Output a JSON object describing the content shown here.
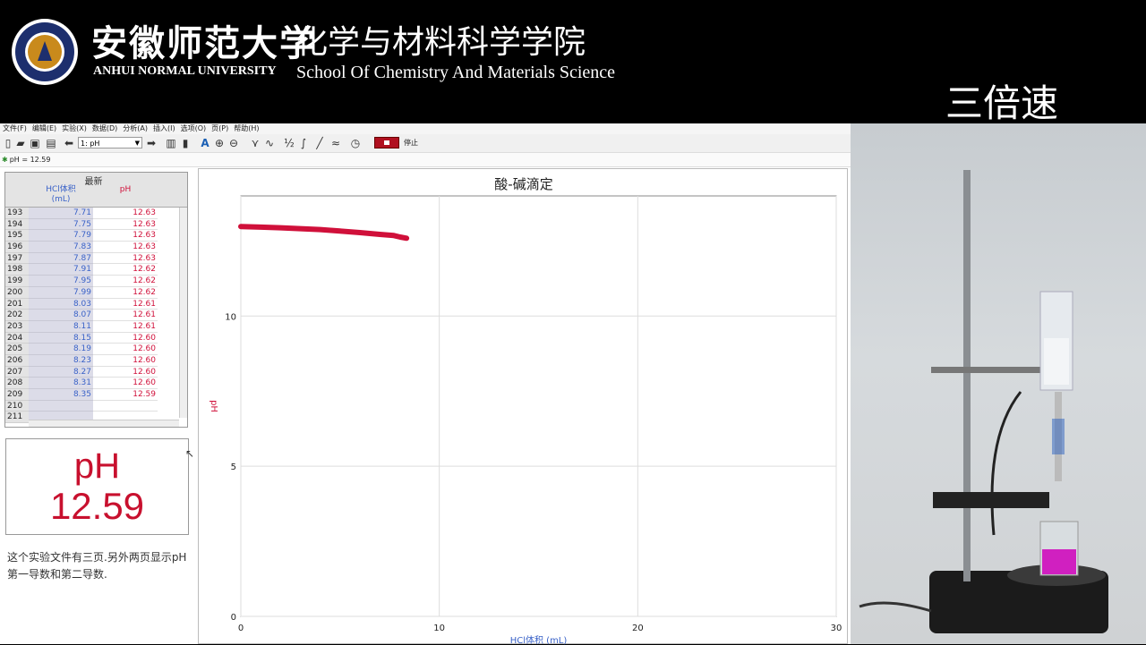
{
  "banner": {
    "university_cn": "安徽师范大学",
    "university_en": "ANHUI NORMAL UNIVERSITY",
    "school_cn": "化学与材料科学学院",
    "school_en": "School Of  Chemistry And Materials Science",
    "speed_label": "三倍速"
  },
  "menu": [
    "文件(F)",
    "编辑(E)",
    "实验(X)",
    "数据(D)",
    "分析(A)",
    "插入(I)",
    "选项(O)",
    "页(P)",
    "帮助(H)"
  ],
  "toolbar": {
    "run_select": "1: pH",
    "stop_label": "停止"
  },
  "status": {
    "text": "pH = 12.59"
  },
  "table": {
    "group_header": "最新",
    "col1_header": "HCl体积\n(mL)",
    "col2_header": "pH",
    "rows": [
      {
        "idx": "193",
        "v": "7.71",
        "ph": "12.63"
      },
      {
        "idx": "194",
        "v": "7.75",
        "ph": "12.63"
      },
      {
        "idx": "195",
        "v": "7.79",
        "ph": "12.63"
      },
      {
        "idx": "196",
        "v": "7.83",
        "ph": "12.63"
      },
      {
        "idx": "197",
        "v": "7.87",
        "ph": "12.63"
      },
      {
        "idx": "198",
        "v": "7.91",
        "ph": "12.62"
      },
      {
        "idx": "199",
        "v": "7.95",
        "ph": "12.62"
      },
      {
        "idx": "200",
        "v": "7.99",
        "ph": "12.62"
      },
      {
        "idx": "201",
        "v": "8.03",
        "ph": "12.61"
      },
      {
        "idx": "202",
        "v": "8.07",
        "ph": "12.61"
      },
      {
        "idx": "203",
        "v": "8.11",
        "ph": "12.61"
      },
      {
        "idx": "204",
        "v": "8.15",
        "ph": "12.60"
      },
      {
        "idx": "205",
        "v": "8.19",
        "ph": "12.60"
      },
      {
        "idx": "206",
        "v": "8.23",
        "ph": "12.60"
      },
      {
        "idx": "207",
        "v": "8.27",
        "ph": "12.60"
      },
      {
        "idx": "208",
        "v": "8.31",
        "ph": "12.60"
      },
      {
        "idx": "209",
        "v": "8.35",
        "ph": "12.59"
      },
      {
        "idx": "210",
        "v": "",
        "ph": ""
      },
      {
        "idx": "211",
        "v": "",
        "ph": ""
      }
    ]
  },
  "meter": {
    "name": "pH",
    "value": "12.59"
  },
  "note": {
    "text": "这个实验文件有三页.另外两页显示pH第一导数和第二导数."
  },
  "chart_data": {
    "type": "line",
    "title": "酸-碱滴定",
    "xlabel": "HCl体积 (mL)",
    "ylabel": "pH",
    "xlim": [
      0,
      30
    ],
    "ylim": [
      0,
      14
    ],
    "xticks": [
      0,
      10,
      20,
      30
    ],
    "yticks": [
      0,
      5,
      10
    ],
    "grid": true,
    "series": [
      {
        "color": "#d0103a",
        "x": [
          0,
          1,
          2,
          3,
          4,
          5,
          6,
          7,
          7.71,
          8.03,
          8.35
        ],
        "y": [
          12.98,
          12.96,
          12.94,
          12.91,
          12.88,
          12.83,
          12.78,
          12.72,
          12.68,
          12.63,
          12.59
        ]
      }
    ]
  }
}
